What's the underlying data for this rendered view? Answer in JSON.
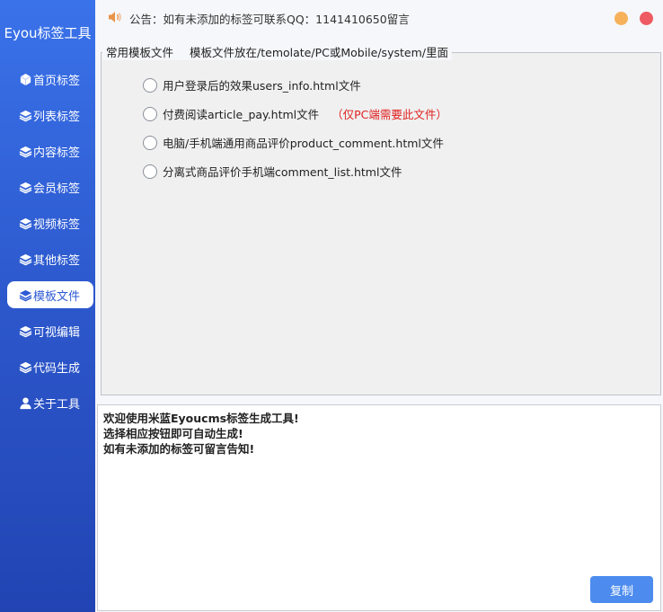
{
  "app": {
    "title": "Eyou标签工具"
  },
  "sidebar": {
    "items": [
      {
        "label": "首页标签",
        "icon": "cube-icon"
      },
      {
        "label": "列表标签",
        "icon": "layers-icon"
      },
      {
        "label": "内容标签",
        "icon": "layers-icon"
      },
      {
        "label": "会员标签",
        "icon": "layers-icon"
      },
      {
        "label": "视频标签",
        "icon": "layers-icon"
      },
      {
        "label": "其他标签",
        "icon": "layers-icon"
      },
      {
        "label": "模板文件",
        "icon": "layers-icon",
        "active": true
      },
      {
        "label": "可视编辑",
        "icon": "layers-icon"
      },
      {
        "label": "代码生成",
        "icon": "layers-icon"
      },
      {
        "label": "关于工具",
        "icon": "user-icon"
      }
    ]
  },
  "topbar": {
    "notice": "公告：如有未添加的标签可联系QQ：1141410650留言"
  },
  "group": {
    "title": "常用模板文件",
    "hint": "模板文件放在/temolate/PC或Mobile/system/里面",
    "options": [
      {
        "label": "用户登录后的效果users_info.html文件",
        "note": ""
      },
      {
        "label": "付费阅读article_pay.html文件",
        "note": "（仅PC端需要此文件）"
      },
      {
        "label": "电脑/手机端通用商品评价product_comment.html文件",
        "note": ""
      },
      {
        "label": "分离式商品评价手机端comment_list.html文件",
        "note": ""
      }
    ]
  },
  "output": {
    "lines": [
      "欢迎使用米蓝Eyoucms标签生成工具!",
      "选择相应按钮即可自动生成!",
      "如有未添加的标签可留言告知!"
    ]
  },
  "buttons": {
    "copy": "复制"
  },
  "colors": {
    "sidebar": "#2d5ad4",
    "accent": "#4d8cee",
    "note": "#e02020"
  }
}
